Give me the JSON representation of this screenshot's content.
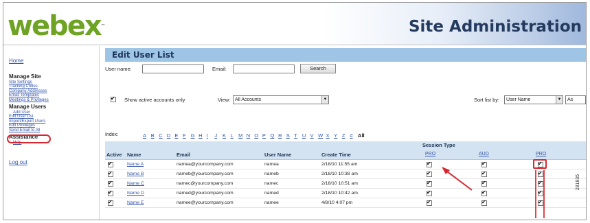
{
  "header": {
    "logo": "webex",
    "logo_tm": "™",
    "site_title": "Site Administration"
  },
  "sidebar": {
    "home": "Home",
    "manage_site": "Manage Site",
    "manage_site_items": [
      "Site Settings",
      "Tracking Codes",
      "Company Addresses",
      "Email Templates",
      "Meetings & Privileges"
    ],
    "manage_users": "Manage Users",
    "manage_users_items": [
      "Add User",
      "Edit User List",
      "Import/Export Users",
      "Edit Privileges",
      "Send Email to All"
    ],
    "assistance": "Assistance",
    "assistance_items": [
      "Help"
    ],
    "logout": "Log out"
  },
  "main": {
    "title": "Edit User List",
    "user_name_label": "User name:",
    "user_name_value": "",
    "email_label": "Email:",
    "email_value": "",
    "search_button": "Search",
    "show_active_label": "Show active accounts only",
    "show_active_checked": true,
    "view_label": "View:",
    "view_value": "All Accounts",
    "sort_label": "Sort list by:",
    "sort_value": "User Name",
    "sort_order_value": "As",
    "index_label": "Index:",
    "index_letters": [
      "A",
      "B",
      "C",
      "D",
      "E",
      "F",
      "G",
      "H",
      "I",
      "J",
      "K",
      "L",
      "M",
      "N",
      "O",
      "P",
      "Q",
      "R",
      "S",
      "T",
      "U",
      "V",
      "W",
      "X",
      "Y",
      "Z",
      "#"
    ],
    "index_all": "All",
    "table": {
      "session_type_header": "Session Type",
      "columns": {
        "active": "Active",
        "name": "Name",
        "email": "Email",
        "user_name": "User Name",
        "create_time": "Create Time",
        "pro1": "PRO",
        "aud": "AUD",
        "pro2": "PRO"
      },
      "rows": [
        {
          "name": "Name A",
          "email": "namea@yourcompany.com",
          "user_name": "namea",
          "create_time": "2/18/10 11:55 am"
        },
        {
          "name": "Name B",
          "email": "nameb@yourcompany.com",
          "user_name": "nameb",
          "create_time": "2/18/10 10:38 am"
        },
        {
          "name": "Name C",
          "email": "namec@yourcompany.com",
          "user_name": "namec",
          "create_time": "2/18/10 10:51 am"
        },
        {
          "name": "Name D",
          "email": "named@yourcompany.com",
          "user_name": "named",
          "create_time": "2/18/10 10:42 am"
        },
        {
          "name": "Name E",
          "email": "namee@yourcompany.com",
          "user_name": "namee",
          "create_time": "4/8/10 4:07 pm"
        }
      ]
    }
  },
  "figure_id": "281835",
  "colors": {
    "title_bar": "#9ec4e6",
    "header_band": "#d4e3f1",
    "highlight": "#d8262e",
    "link": "#3355aa",
    "logo": "#6ea324"
  }
}
